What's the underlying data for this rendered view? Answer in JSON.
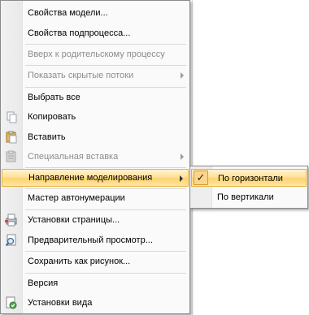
{
  "menu": {
    "items": [
      {
        "label": "Свойства модели...",
        "icon": "",
        "disabled": false
      },
      {
        "label": "Свойства подпроцесса...",
        "icon": "",
        "disabled": false
      },
      {
        "label": "Вверх к родительскому процессу",
        "icon": "",
        "disabled": true
      },
      {
        "label": "Показать скрытые потоки",
        "icon": "",
        "disabled": true,
        "submenu": true
      },
      {
        "label": "Выбрать все",
        "icon": "",
        "disabled": false
      },
      {
        "label": "Копировать",
        "icon": "copy-icon",
        "disabled": false
      },
      {
        "label": "Вставить",
        "icon": "paste-icon",
        "disabled": false
      },
      {
        "label": "Специальная вставка",
        "icon": "paste-special-icon",
        "disabled": true,
        "submenu": true
      },
      {
        "label": "Направление моделирования",
        "icon": "",
        "disabled": false,
        "submenu": true,
        "active": true
      },
      {
        "label": "Мастер автонумерации",
        "icon": "",
        "disabled": false
      },
      {
        "label": "Установки страницы...",
        "icon": "page-setup-icon",
        "disabled": false
      },
      {
        "label": "Предварительный просмотр...",
        "icon": "print-preview-icon",
        "disabled": false
      },
      {
        "label": "Сохранить как рисунок...",
        "icon": "",
        "disabled": false
      },
      {
        "label": "Версия",
        "icon": "",
        "disabled": false
      },
      {
        "label": "Установки вида",
        "icon": "view-settings-icon",
        "disabled": false
      }
    ]
  },
  "submenu": {
    "items": [
      {
        "label": "По горизонтали",
        "checked": true,
        "check_glyph": "✓"
      },
      {
        "label": "По вертикали",
        "checked": false
      }
    ]
  },
  "colors": {
    "highlight": "#ffe29a",
    "highlight_border": "#e6b23c",
    "disabled_text": "#8d8d8d"
  }
}
